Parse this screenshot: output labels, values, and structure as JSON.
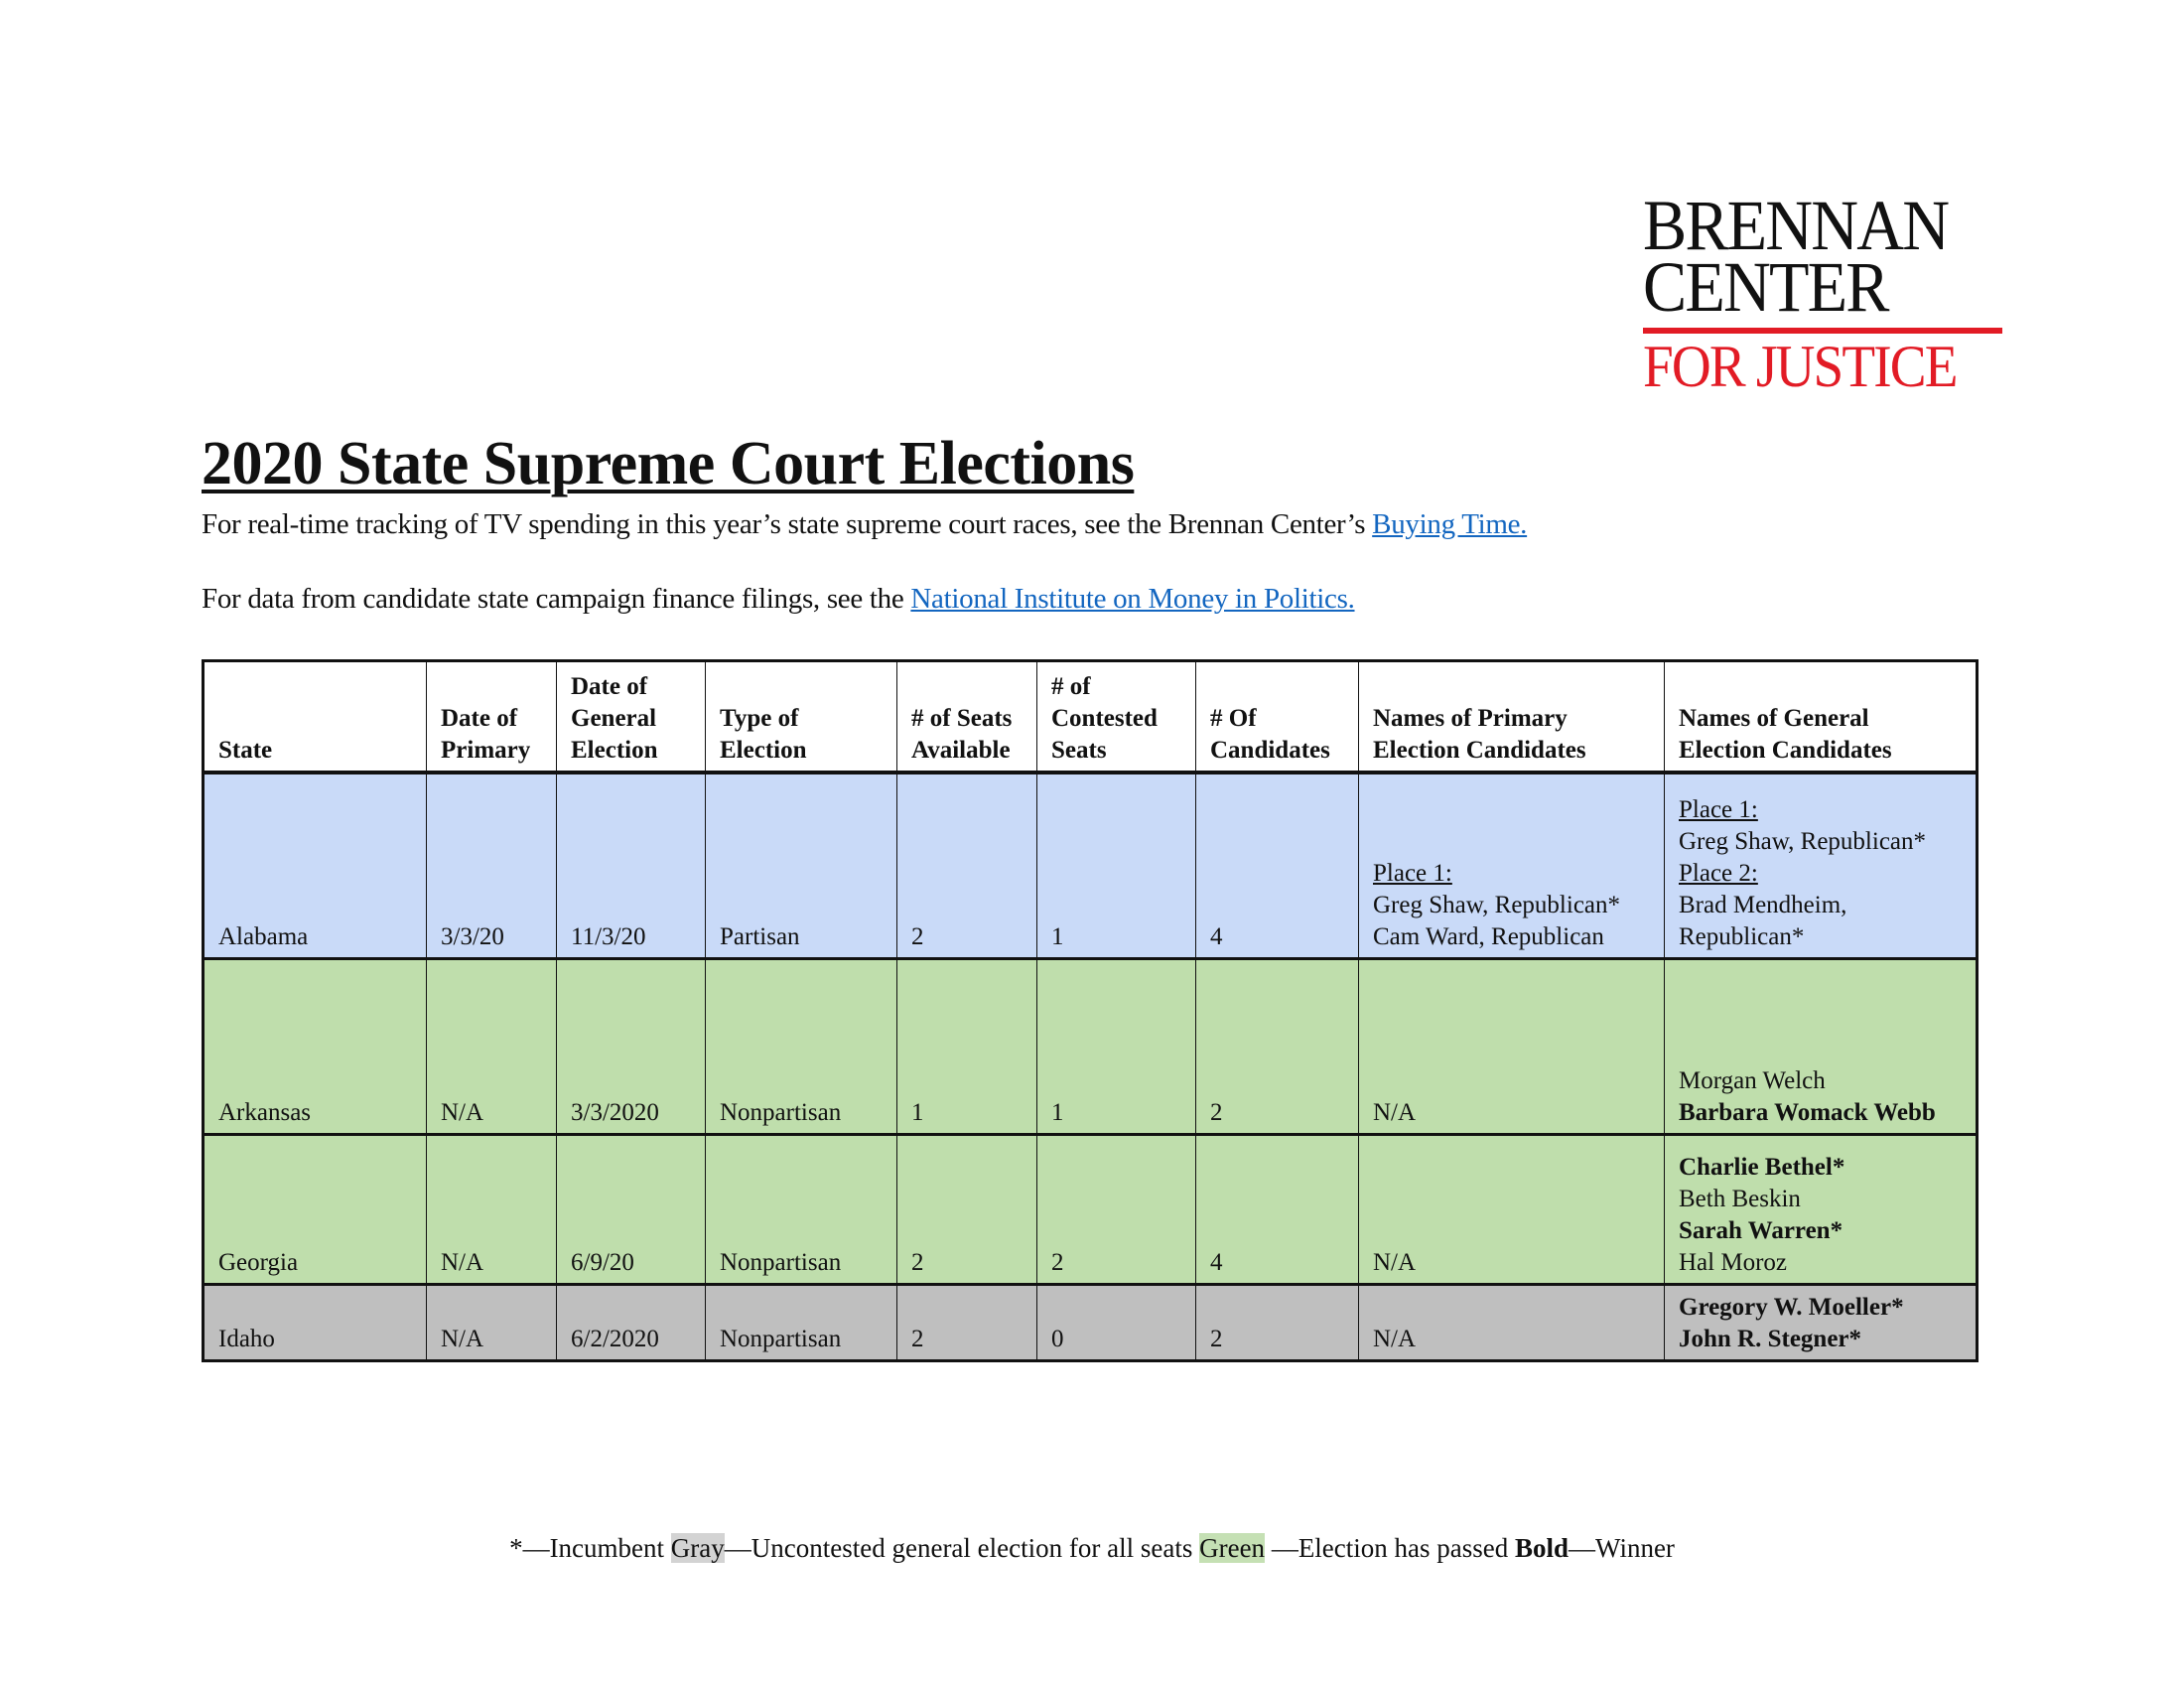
{
  "logo": {
    "line1": "BRENNAN",
    "line2": "CENTER",
    "line3": "FOR JUSTICE",
    "brand_red": "#e21b25"
  },
  "title": "2020 State Supreme Court Elections",
  "intro": {
    "p1_text": "For real-time tracking of TV spending in this year’s state supreme court races, see the Brennan Center’s ",
    "p1_link": "Buying Time.",
    "p2_text": "For data from candidate state campaign finance filings, see the ",
    "p2_link": "National Institute on Money in Politics.",
    "link_color": "#1366c0"
  },
  "table": {
    "headers": [
      "State",
      "Date of Primary",
      "Date of General Election",
      "Type of Election",
      "# of Seats Available",
      "# of Contested Seats",
      "# Of Candidates",
      "Names of Primary Election Candidates",
      "Names of General Election Candidates"
    ],
    "rows": [
      {
        "state": "Alabama",
        "primary": "3/3/20",
        "general": "11/3/20",
        "type": "Partisan",
        "seats": "2",
        "contested": "1",
        "candidates": "4",
        "primary_names": {
          "place1_label": "Place 1:",
          "line1": "Greg Shaw, Republican*",
          "line2": "Cam Ward, Republican"
        },
        "general_names": {
          "place1_label": "Place 1:",
          "place1_name": "Greg Shaw, Republican*",
          "place2_label": "Place 2:",
          "place2_name_a": "Brad Mendheim,",
          "place2_name_b": "Republican*"
        },
        "color": "#c9daf8"
      },
      {
        "state": "Arkansas",
        "primary": "N/A",
        "general": "3/3/2020",
        "type": "Nonpartisan",
        "seats": "1",
        "contested": "1",
        "candidates": "2",
        "primary_names": "N/A",
        "general_names": [
          {
            "name": "Morgan Welch",
            "winner": false
          },
          {
            "name": "Barbara Womack Webb",
            "winner": true
          }
        ],
        "color": "#bfdeac"
      },
      {
        "state": "Georgia",
        "primary": "N/A",
        "general": "6/9/20",
        "type": "Nonpartisan",
        "seats": "2",
        "contested": "2",
        "candidates": "4",
        "primary_names": "N/A",
        "general_names": [
          {
            "name": "Charlie Bethel*",
            "winner": true
          },
          {
            "name": "Beth Beskin",
            "winner": false
          },
          {
            "name": "Sarah Warren*",
            "winner": true
          },
          {
            "name": "Hal Moroz",
            "winner": false
          }
        ],
        "color": "#bfdeac"
      },
      {
        "state": "Idaho",
        "primary": "N/A",
        "general": "6/2/2020",
        "type": "Nonpartisan",
        "seats": "2",
        "contested": "0",
        "candidates": "2",
        "primary_names": "N/A",
        "general_names": [
          {
            "name": "Gregory W. Moeller*",
            "winner": true
          },
          {
            "name": "John R. Stegner*",
            "winner": true
          }
        ],
        "color": "#bfbfbf"
      }
    ]
  },
  "legend": {
    "incumbent": "*—Incumbent ",
    "gray_word": "Gray",
    "gray_desc": "—Uncontested general election for all seats ",
    "green_word": "Green",
    "green_desc": " —Election has passed ",
    "bold_word": "Bold",
    "bold_desc": "—Winner"
  }
}
